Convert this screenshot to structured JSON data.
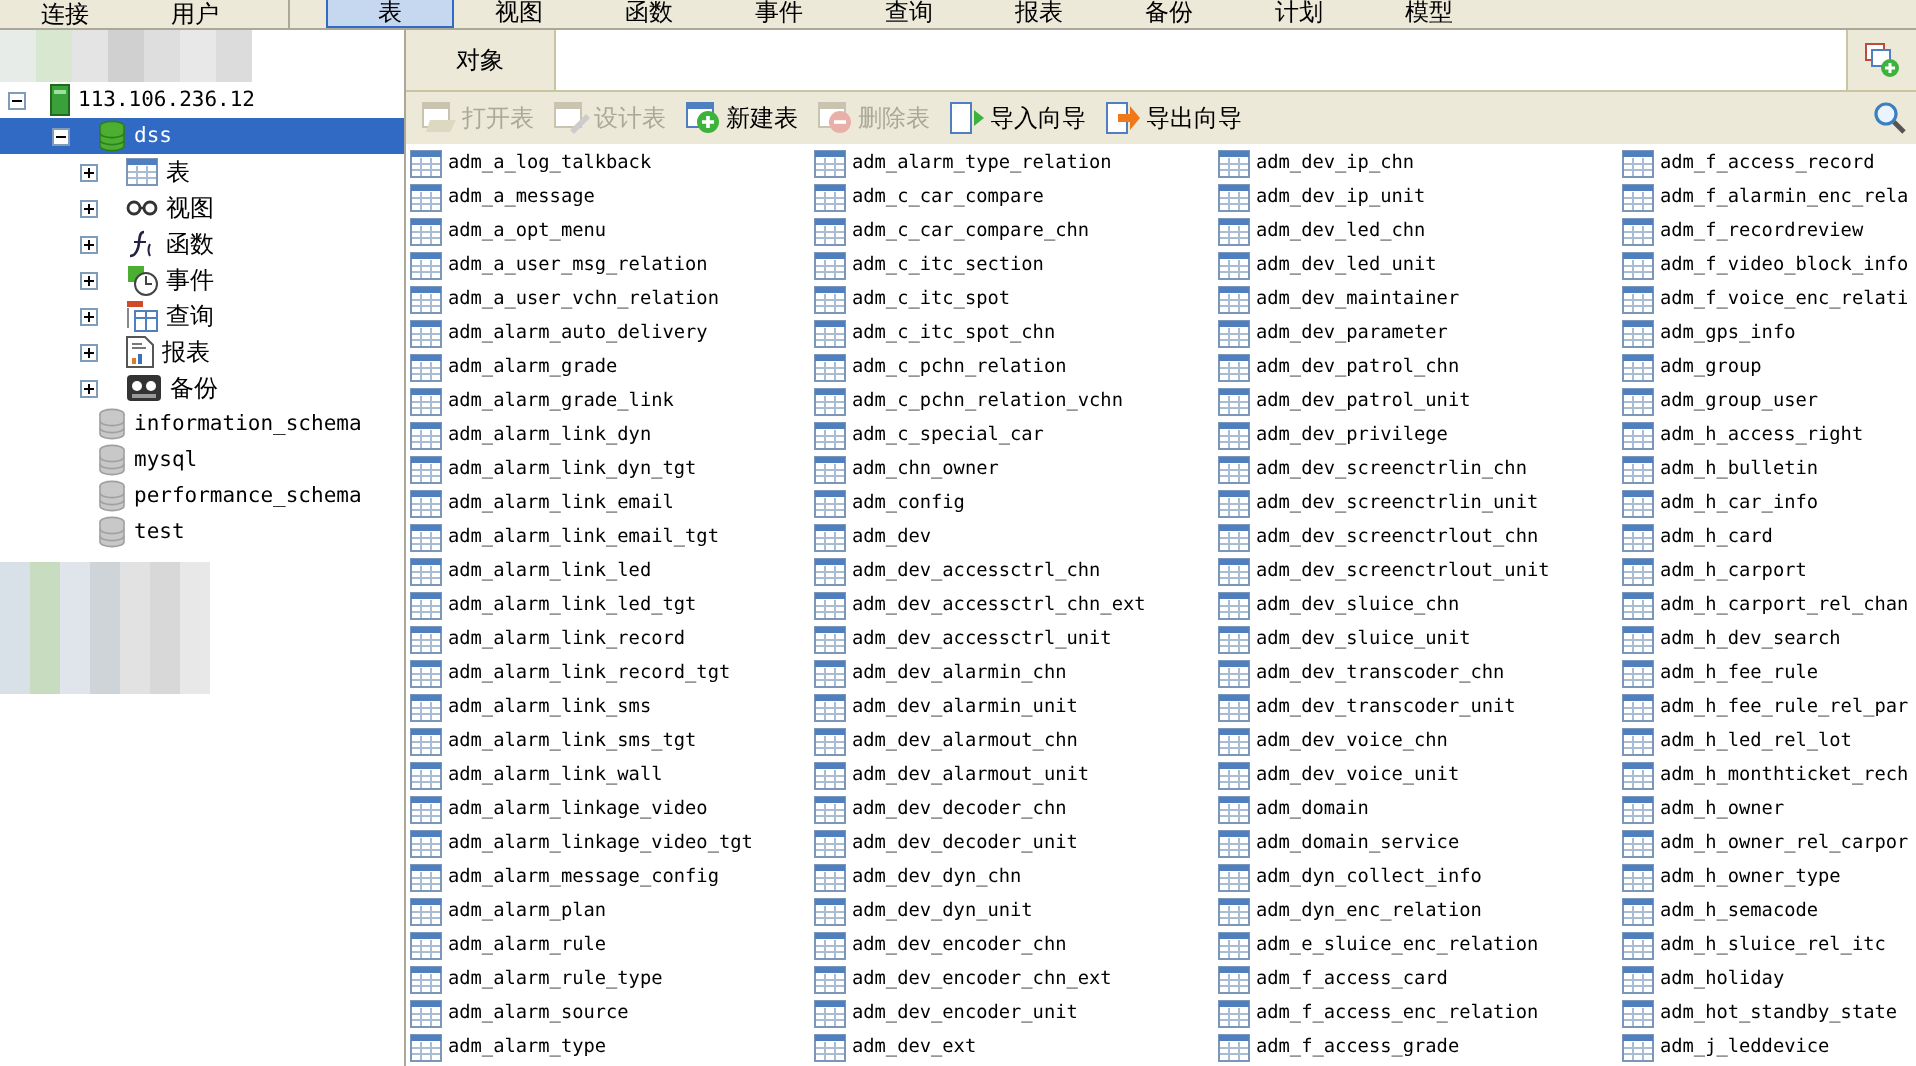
{
  "menu": {
    "left": [
      {
        "label": "连接",
        "selected": false
      },
      {
        "label": "用户",
        "selected": false
      }
    ],
    "right": [
      {
        "label": "表",
        "selected": true
      },
      {
        "label": "视图",
        "selected": false
      },
      {
        "label": "函数",
        "selected": false
      },
      {
        "label": "事件",
        "selected": false
      },
      {
        "label": "查询",
        "selected": false
      },
      {
        "label": "报表",
        "selected": false
      },
      {
        "label": "备份",
        "selected": false
      },
      {
        "label": "计划",
        "selected": false
      },
      {
        "label": "模型",
        "selected": false
      }
    ]
  },
  "tree": [
    {
      "label": "113.106.236.12",
      "kind": "server",
      "expanded": true,
      "selected": false,
      "children": [
        {
          "label": "dss",
          "kind": "database",
          "connected": true,
          "expanded": true,
          "selected": true,
          "children": [
            {
              "label": "表",
              "kind": "tables",
              "expanded": false,
              "selected": false
            },
            {
              "label": "视图",
              "kind": "views",
              "expanded": false,
              "selected": false
            },
            {
              "label": "函数",
              "kind": "functions",
              "expanded": false,
              "selected": false
            },
            {
              "label": "事件",
              "kind": "events",
              "expanded": false,
              "selected": false
            },
            {
              "label": "查询",
              "kind": "queries",
              "expanded": false,
              "selected": false
            },
            {
              "label": "报表",
              "kind": "reports",
              "expanded": false,
              "selected": false
            },
            {
              "label": "备份",
              "kind": "backups",
              "expanded": false,
              "selected": false
            }
          ]
        },
        {
          "label": "information_schema",
          "kind": "database",
          "connected": false,
          "selected": false
        },
        {
          "label": "mysql",
          "kind": "database",
          "connected": false,
          "selected": false
        },
        {
          "label": "performance_schema",
          "kind": "database",
          "connected": false,
          "selected": false
        },
        {
          "label": "test",
          "kind": "database",
          "connected": false,
          "selected": false
        }
      ]
    }
  ],
  "object_tab": {
    "label": "对象",
    "selected": true
  },
  "toolbar": [
    {
      "label": "打开表",
      "kind": "open",
      "disabled": true
    },
    {
      "label": "设计表",
      "kind": "design",
      "disabled": true
    },
    {
      "label": "新建表",
      "kind": "new",
      "disabled": false
    },
    {
      "label": "删除表",
      "kind": "delete",
      "disabled": true
    },
    {
      "label": "导入向导",
      "kind": "import",
      "disabled": false
    },
    {
      "label": "导出向导",
      "kind": "export",
      "disabled": false
    }
  ],
  "tables": [
    [
      "adm_a_log_talkback",
      "adm_a_message",
      "adm_a_opt_menu",
      "adm_a_user_msg_relation",
      "adm_a_user_vchn_relation",
      "adm_alarm_auto_delivery",
      "adm_alarm_grade",
      "adm_alarm_grade_link",
      "adm_alarm_link_dyn",
      "adm_alarm_link_dyn_tgt",
      "adm_alarm_link_email",
      "adm_alarm_link_email_tgt",
      "adm_alarm_link_led",
      "adm_alarm_link_led_tgt",
      "adm_alarm_link_record",
      "adm_alarm_link_record_tgt",
      "adm_alarm_link_sms",
      "adm_alarm_link_sms_tgt",
      "adm_alarm_link_wall",
      "adm_alarm_linkage_video",
      "adm_alarm_linkage_video_tgt",
      "adm_alarm_message_config",
      "adm_alarm_plan",
      "adm_alarm_rule",
      "adm_alarm_rule_type",
      "adm_alarm_source",
      "adm_alarm_type"
    ],
    [
      "adm_alarm_type_relation",
      "adm_c_car_compare",
      "adm_c_car_compare_chn",
      "adm_c_itc_section",
      "adm_c_itc_spot",
      "adm_c_itc_spot_chn",
      "adm_c_pchn_relation",
      "adm_c_pchn_relation_vchn",
      "adm_c_special_car",
      "adm_chn_owner",
      "adm_config",
      "adm_dev",
      "adm_dev_accessctrl_chn",
      "adm_dev_accessctrl_chn_ext",
      "adm_dev_accessctrl_unit",
      "adm_dev_alarmin_chn",
      "adm_dev_alarmin_unit",
      "adm_dev_alarmout_chn",
      "adm_dev_alarmout_unit",
      "adm_dev_decoder_chn",
      "adm_dev_decoder_unit",
      "adm_dev_dyn_chn",
      "adm_dev_dyn_unit",
      "adm_dev_encoder_chn",
      "adm_dev_encoder_chn_ext",
      "adm_dev_encoder_unit",
      "adm_dev_ext"
    ],
    [
      "adm_dev_ip_chn",
      "adm_dev_ip_unit",
      "adm_dev_led_chn",
      "adm_dev_led_unit",
      "adm_dev_maintainer",
      "adm_dev_parameter",
      "adm_dev_patrol_chn",
      "adm_dev_patrol_unit",
      "adm_dev_privilege",
      "adm_dev_screenctrlin_chn",
      "adm_dev_screenctrlin_unit",
      "adm_dev_screenctrlout_chn",
      "adm_dev_screenctrlout_unit",
      "adm_dev_sluice_chn",
      "adm_dev_sluice_unit",
      "adm_dev_transcoder_chn",
      "adm_dev_transcoder_unit",
      "adm_dev_voice_chn",
      "adm_dev_voice_unit",
      "adm_domain",
      "adm_domain_service",
      "adm_dyn_collect_info",
      "adm_dyn_enc_relation",
      "adm_e_sluice_enc_relation",
      "adm_f_access_card",
      "adm_f_access_enc_relation",
      "adm_f_access_grade"
    ],
    [
      "adm_f_access_record",
      "adm_f_alarmin_enc_rela",
      "adm_f_recordreview",
      "adm_f_video_block_info",
      "adm_f_voice_enc_relati",
      "adm_gps_info",
      "adm_group",
      "adm_group_user",
      "adm_h_access_right",
      "adm_h_bulletin",
      "adm_h_car_info",
      "adm_h_card",
      "adm_h_carport",
      "adm_h_carport_rel_chan",
      "adm_h_dev_search",
      "adm_h_fee_rule",
      "adm_h_fee_rule_rel_par",
      "adm_h_led_rel_lot",
      "adm_h_monthticket_rech",
      "adm_h_owner",
      "adm_h_owner_rel_carpor",
      "adm_h_owner_type",
      "adm_h_semacode",
      "adm_h_sluice_rel_itc",
      "adm_holiday",
      "adm_hot_standby_state",
      "adm_j_leddevice"
    ]
  ]
}
